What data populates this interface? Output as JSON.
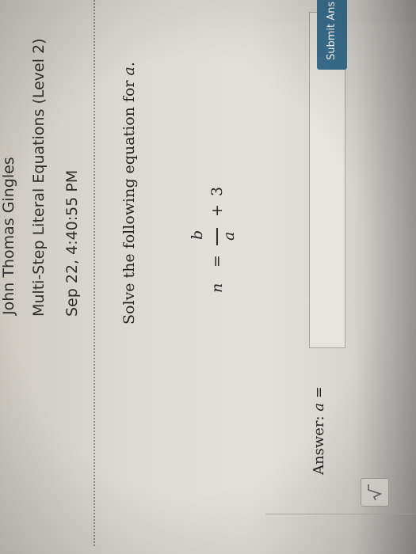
{
  "header": {
    "student_name": "John Thomas Gingles",
    "assignment_title": "Multi-Step Literal Equations (Level 2)",
    "timestamp": "Sep 22, 4:40:55 PM"
  },
  "question": {
    "prompt": "Solve the following equation for",
    "variable": "a",
    "period": "."
  },
  "equation": {
    "lhs": "n",
    "equals": "=",
    "numerator": "b",
    "denominator": "a",
    "plus": "+",
    "constant": "3"
  },
  "answer": {
    "label": "Answer:",
    "variable": "a",
    "equals": "=",
    "value": ""
  },
  "buttons": {
    "submit_label": "Submit Ans",
    "sqrt_icon": "square-root-icon"
  }
}
